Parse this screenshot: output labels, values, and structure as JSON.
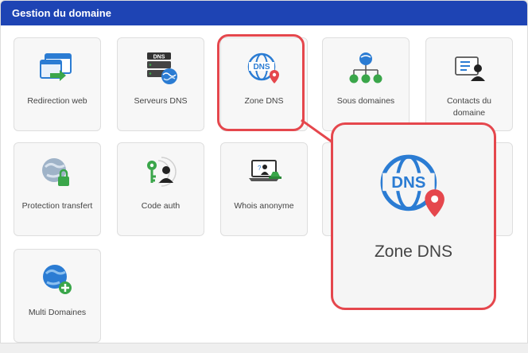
{
  "panel": {
    "title": "Gestion du domaine"
  },
  "tiles": [
    {
      "label": "Redirection web",
      "icon": "redirect-window-icon"
    },
    {
      "label": "Serveurs DNS",
      "icon": "dns-server-icon"
    },
    {
      "label": "Zone DNS",
      "icon": "dns-globe-pin-icon"
    },
    {
      "label": "Sous domaines",
      "icon": "subdomain-tree-icon"
    },
    {
      "label": "Contacts du domaine",
      "icon": "contact-card-icon"
    },
    {
      "label": "Protection transfert",
      "icon": "globe-lock-icon"
    },
    {
      "label": "Code auth",
      "icon": "key-user-icon"
    },
    {
      "label": "Whois anonyme",
      "icon": "anonymous-laptop-icon"
    },
    {
      "label": "Multi Domaines",
      "icon": "globe-plus-icon"
    }
  ],
  "zoom": {
    "label": "Zone DNS",
    "icon": "dns-globe-pin-icon"
  },
  "colors": {
    "header": "#1e44b4",
    "highlight": "#e5474d",
    "globe": "#2b7cd3",
    "pin": "#e5474d",
    "green": "#3aa64a"
  }
}
